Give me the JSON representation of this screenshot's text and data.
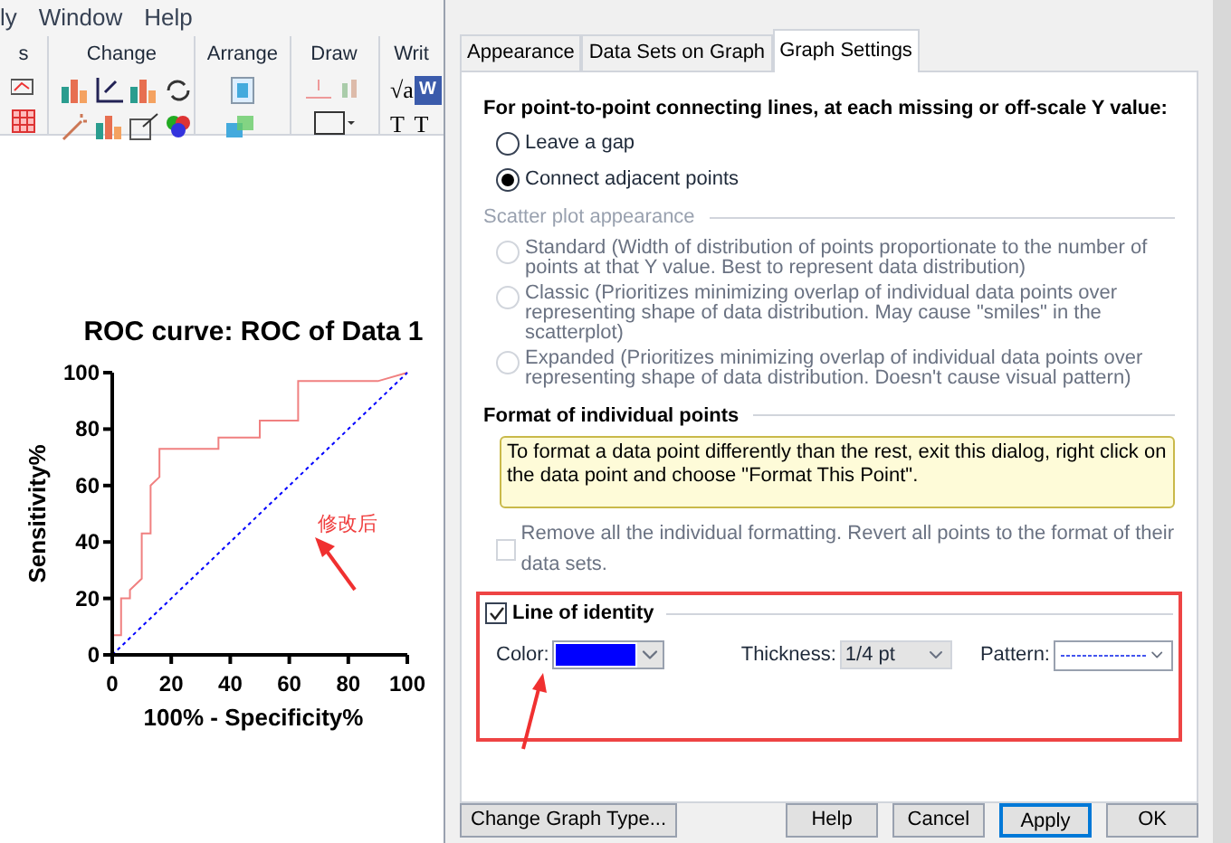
{
  "menu": [
    "ly",
    "Window",
    "Help"
  ],
  "ribbon": [
    {
      "label": "s",
      "kind": "partial"
    },
    {
      "label": "Change",
      "kind": "change"
    },
    {
      "label": "Arrange",
      "kind": "arrange"
    },
    {
      "label": "Draw",
      "kind": "draw"
    },
    {
      "label": "Writ",
      "kind": "write",
      "glyphs": [
        "√a",
        "W",
        "T",
        "T"
      ]
    }
  ],
  "graph": {
    "chart_data": {
      "type": "line",
      "title": "ROC curve: ROC of Data 1",
      "xlabel": "100% - Specificity%",
      "ylabel": "Sensitivity%",
      "x": [
        0,
        0,
        3,
        3,
        6,
        6,
        10,
        10,
        13,
        13,
        16,
        16,
        36,
        36,
        50,
        50,
        63,
        63,
        90,
        100
      ],
      "series": [
        {
          "color": "#f08080",
          "line_style": "solid",
          "values": [
            0,
            7,
            7,
            20,
            20,
            23,
            27,
            43,
            43,
            60,
            63,
            73,
            73,
            77,
            77,
            83,
            83,
            97,
            97,
            100
          ]
        },
        {
          "color": "#0000ff",
          "line_style": "dashed",
          "values": [
            0,
            0,
            3,
            3,
            6,
            6,
            10,
            10,
            13,
            13,
            16,
            16,
            36,
            36,
            50,
            50,
            63,
            63,
            90,
            100
          ]
        }
      ],
      "xlim": [
        0,
        100
      ],
      "ylim": [
        0,
        100
      ],
      "xticks": [
        0,
        20,
        40,
        60,
        80,
        100
      ],
      "yticks": [
        0,
        20,
        40,
        60,
        80,
        100
      ]
    },
    "note": "修改后"
  },
  "dialog": {
    "tabs": [
      {
        "label": "Appearance",
        "selected": false
      },
      {
        "label": "Data Sets on Graph",
        "selected": false
      },
      {
        "label": "Graph Settings",
        "selected": true
      }
    ],
    "missing_values": {
      "title": "For point-to-point connecting lines, at each missing or off-scale Y value:",
      "options": [
        {
          "label": "Leave a gap",
          "selected": false
        },
        {
          "label": "Connect adjacent points",
          "selected": true
        }
      ]
    },
    "scatter": {
      "title": "Scatter plot appearance",
      "disabled": true,
      "options": [
        {
          "label": "Standard (Width of distribution of points proportionate to the number of points at that Y value. Best to represent data distribution)",
          "selected": false
        },
        {
          "label": "Classic (Prioritizes minimizing overlap of individual data points over representing shape of data distribution. May cause \"smiles\" in the scatterplot)",
          "selected": false
        },
        {
          "label": "Expanded (Prioritizes minimizing overlap of individual data points over representing shape of data distribution. Doesn't cause visual pattern)",
          "selected": false
        }
      ]
    },
    "individual": {
      "title": "Format of individual points",
      "hint": "To format a data point differently than the rest, exit this dialog, right click on the data point and choose \"Format This Point\".",
      "remove": {
        "label": "Remove all the individual formatting. Revert all points to the format of their data sets.",
        "checked": false,
        "disabled": true
      }
    },
    "identity": {
      "label": "Line of identity",
      "checked": true,
      "color_label": "Color:",
      "color": "#0000ff",
      "thickness_label": "Thickness:",
      "thickness": "1/4 pt",
      "pattern_label": "Pattern:",
      "pattern_dashed": true
    },
    "buttons": [
      {
        "label": "Change Graph Type...",
        "kind": "left"
      },
      {
        "label": "Help",
        "kind": "normal"
      },
      {
        "label": "Cancel",
        "kind": "normal"
      },
      {
        "label": "Apply",
        "kind": "default"
      },
      {
        "label": "OK",
        "kind": "normal"
      }
    ]
  }
}
